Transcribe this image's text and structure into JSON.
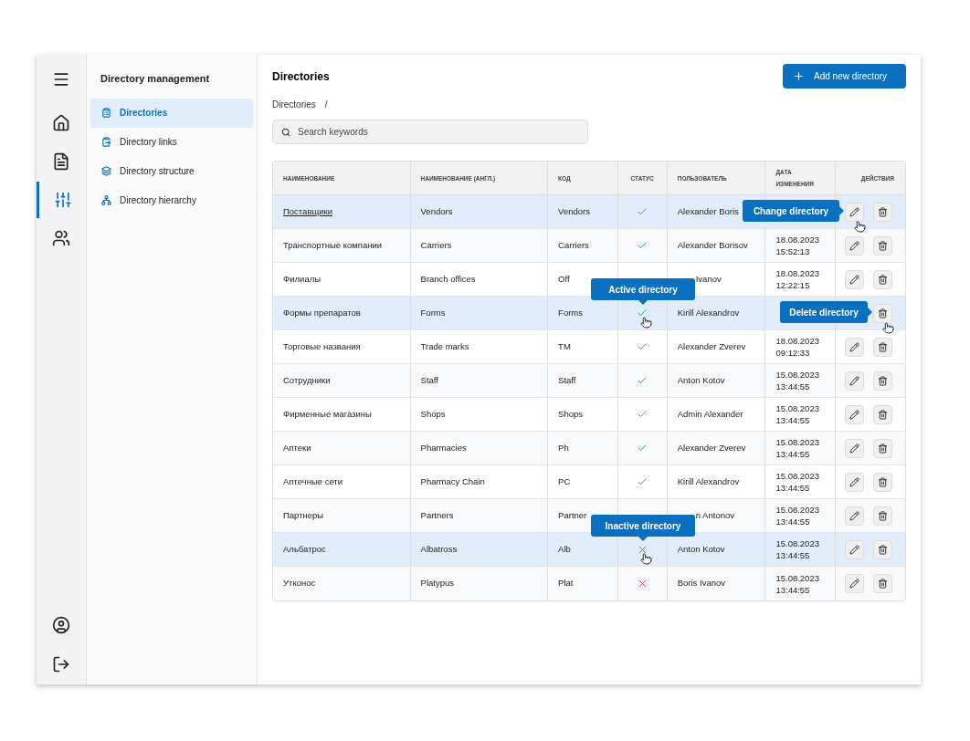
{
  "rail": {
    "items": [
      {
        "kind": "home",
        "selected": false
      },
      {
        "kind": "document",
        "selected": false
      },
      {
        "kind": "sliders",
        "selected": true
      },
      {
        "kind": "users",
        "selected": false
      }
    ]
  },
  "sidebar": {
    "title": "Directory management",
    "items": [
      {
        "label": "Directories",
        "kind": "clipboard",
        "selected": true
      },
      {
        "label": "Directory links",
        "kind": "link",
        "selected": false
      },
      {
        "label": "Directory structure",
        "kind": "stack",
        "selected": false
      },
      {
        "label": "Directory hierarchy",
        "kind": "tree",
        "selected": false
      }
    ]
  },
  "header": {
    "title": "Directories",
    "add_button": "Add new directory"
  },
  "breadcrumb": [
    "Directories",
    "/"
  ],
  "search": {
    "placeholder": "Search keywords"
  },
  "table": {
    "columns": [
      {
        "label": "НАИМЕНОВАНИЕ"
      },
      {
        "label": "НАИМЕНОВАНИЕ (АНГЛ.)"
      },
      {
        "label": "КОД"
      },
      {
        "label": "СТАТУС"
      },
      {
        "label": "ПОЛЬЗОВАТЕЛЬ"
      },
      {
        "label": "ДАТА ИЗМЕНЕНИЯ"
      },
      {
        "label": "ДЕЙСТВИЯ"
      }
    ],
    "rows": [
      {
        "name": "Поставщики",
        "link": true,
        "english": "Vendors",
        "code": "Vendors",
        "active": true,
        "user": "Alexander Boris",
        "highlighted": true,
        "tooltip": {
          "kind": "edit",
          "text": "Change directory"
        }
      },
      {
        "name": "Транспортные компании",
        "link": false,
        "english": "Carriers",
        "code": "Carriers",
        "active": true,
        "user": "Alexander Borisov",
        "date": "18.08.2023",
        "time": "15:52:13",
        "highlighted": false
      },
      {
        "name": "Филиалы",
        "link": false,
        "english": "Branch offices",
        "code": "Off",
        "user": "Ivanov",
        "date": "18.08.2023",
        "time": "12:22:15",
        "highlighted": false
      },
      {
        "name": "Формы препаратов",
        "link": false,
        "english": "Forms",
        "code": "Forms",
        "active": true,
        "user": "Kirill Alexandrov",
        "highlighted": true,
        "tooltip": {
          "kind": "delete",
          "text": "Delete directory"
        },
        "tooltip2": {
          "kind": "status",
          "text": "Active directory"
        }
      },
      {
        "name": "Торговые названия",
        "link": false,
        "english": "Trade marks",
        "code": "TM",
        "active": true,
        "user": "Alexander Zverev",
        "date": "18.08.2023",
        "time": "09:12:33",
        "highlighted": false
      },
      {
        "name": "Сотрудники",
        "link": false,
        "english": "Staff",
        "code": "Staff",
        "active": true,
        "user": "Anton Kotov",
        "date": "15.08.2023",
        "time": "13:44:55",
        "highlighted": false
      },
      {
        "name": "Фирменные магазины",
        "link": false,
        "english": "Shops",
        "code": "Shops",
        "active": true,
        "user": "Admin Alexander",
        "date": "15.08.2023",
        "time": "13:44:55",
        "highlighted": false
      },
      {
        "name": "Аптеки",
        "link": false,
        "english": "Pharmacies",
        "code": "Ph",
        "active": true,
        "user": "Alexander Zverev",
        "date": "15.08.2023",
        "time": "13:44:55",
        "highlighted": false
      },
      {
        "name": "Аптечные сети",
        "link": false,
        "english": "Pharmacy Chain",
        "code": "PC",
        "active": true,
        "user": "Kirill Alexandrov",
        "date": "15.08.2023",
        "time": "13:44:55",
        "highlighted": false
      },
      {
        "name": "Партнеры",
        "link": false,
        "english": "Partners",
        "code": "Partner",
        "user": "n Antonov",
        "date": "15.08.2023",
        "time": "13:44:55",
        "highlighted": false
      },
      {
        "name": "Альбатрос",
        "link": false,
        "english": "Albatross",
        "code": "Alb",
        "active": false,
        "user": "Anton Kotov",
        "date": "15.08.2023",
        "time": "13:44:55",
        "highlighted": true,
        "tooltip2": {
          "kind": "status",
          "text": "Inactive directory"
        }
      },
      {
        "name": "Утконос",
        "link": false,
        "english": "Platypus",
        "code": "Plat",
        "active": false,
        "user": "Boris Ivanov",
        "date": "15.08.2023",
        "time": "13:44:55",
        "highlighted": false
      }
    ]
  }
}
